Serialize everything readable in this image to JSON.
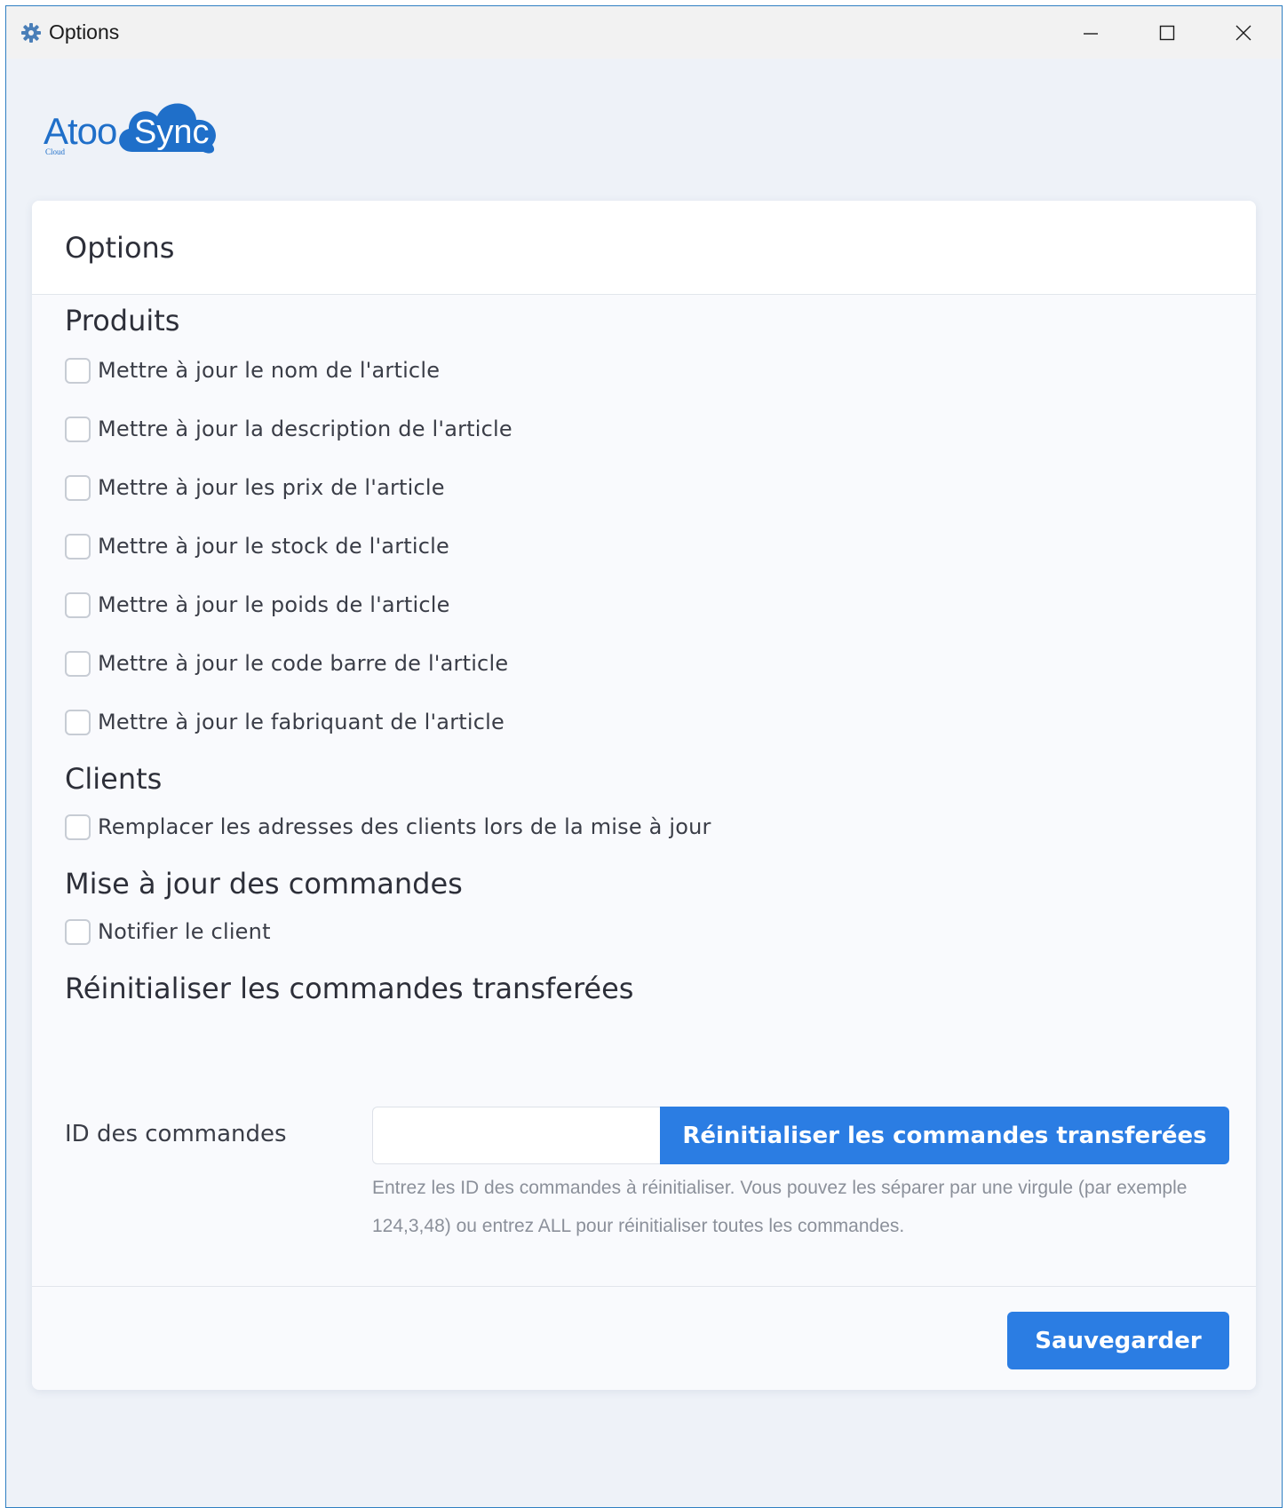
{
  "window": {
    "title": "Options",
    "icon": "gear-icon"
  },
  "logo": {
    "text_left": "Atoo",
    "text_right": "Sync",
    "subtext": "Cloud"
  },
  "card": {
    "title": "Options"
  },
  "sections": {
    "produits": {
      "title": "Produits",
      "options": [
        "Mettre à jour le nom de l'article",
        "Mettre à jour la description de l'article",
        "Mettre à jour les prix de l'article",
        "Mettre à jour le stock de l'article",
        "Mettre à jour le poids de l'article",
        "Mettre à jour le code barre de l'article",
        "Mettre à jour le fabriquant de l'article"
      ]
    },
    "clients": {
      "title": "Clients",
      "options": [
        "Remplacer les adresses des clients lors de la mise à jour"
      ]
    },
    "commandes": {
      "title": "Mise à jour des commandes",
      "options": [
        "Notifier le client"
      ]
    },
    "reset": {
      "title": "Réinitialiser les commandes transferées",
      "label": "ID des commandes",
      "input_value": "",
      "button_label": "Réinitialiser les commandes transferées",
      "help": "Entrez les ID des commandes à réinitialiser. Vous pouvez les séparer par une virgule (par exemple 124,3,48) ou entrez ALL pour réinitialiser toutes les commandes."
    }
  },
  "footer": {
    "save_label": "Sauvegarder"
  },
  "colors": {
    "accent": "#2b7de3",
    "background": "#eef2f8",
    "logo_blue": "#1f6fc9"
  }
}
